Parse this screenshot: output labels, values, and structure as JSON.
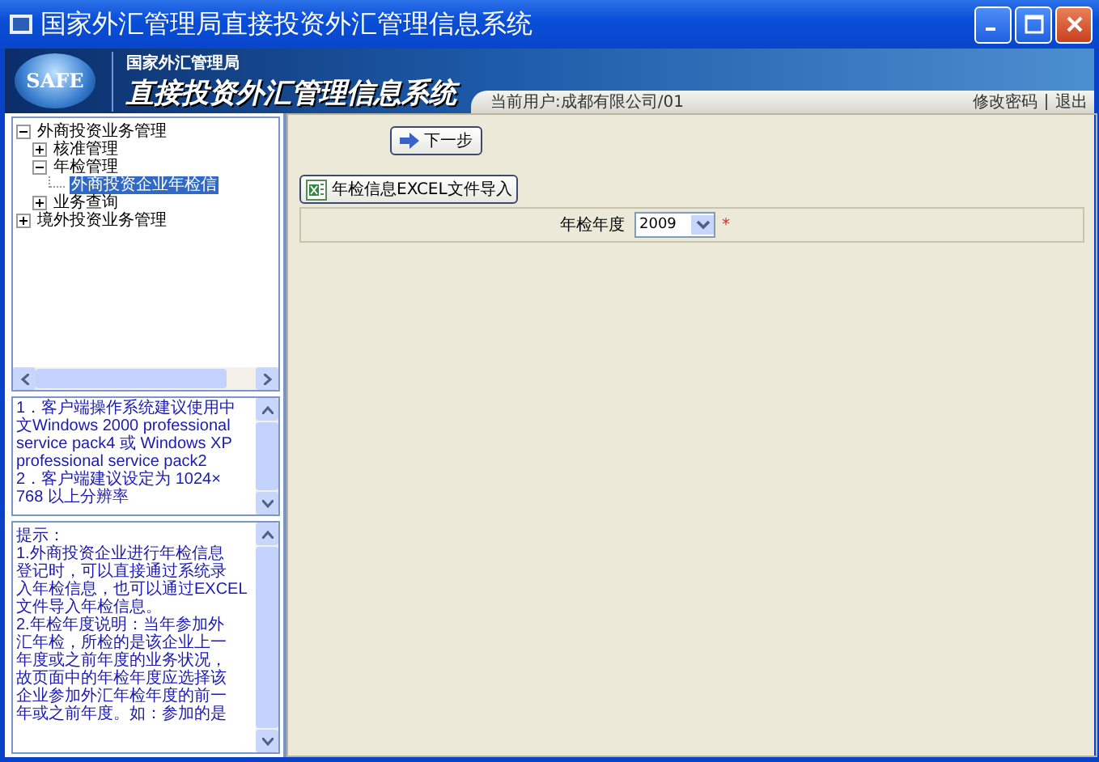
{
  "window": {
    "title": "国家外汇管理局直接投资外汇管理信息系统"
  },
  "header": {
    "logo": "SAFE",
    "subtitle": "国家外汇管理局",
    "title": "直接投资外汇管理信息系统",
    "current_user": "当前用户:成都有限公司/01",
    "links": [
      "修改密码",
      "退出"
    ]
  },
  "tree": [
    {
      "label": "外商投资业务管理",
      "expanded": true,
      "selected": false,
      "children": [
        {
          "label": "核准管理",
          "expanded": false,
          "selected": false
        },
        {
          "label": "年检管理",
          "expanded": true,
          "selected": false,
          "children": [
            {
              "label": "外商投资企业年检信",
              "selected": true
            }
          ]
        },
        {
          "label": "业务查询",
          "expanded": false,
          "selected": false
        }
      ]
    },
    {
      "label": "境外投资业务管理",
      "expanded": false,
      "selected": false
    }
  ],
  "notice": [
    "1．客户端操作系统建议使用中",
    "文Windows 2000 professional",
    "service pack4 或 Windows XP",
    "professional service pack2",
    "2．客户端建议设定为 1024×",
    "768 以上分辨率"
  ],
  "tips": [
    "提示：",
    "1.外商投资企业进行年检信息",
    "登记时，可以直接通过系统录",
    "入年检信息，也可以通过EXCEL",
    "文件导入年检信息。",
    "2.年检年度说明：当年参加外",
    "汇年检，所检的是该企业上一",
    "年度或之前年度的业务状况，",
    "故页面中的年检年度应选择该",
    "企业参加外汇年检年度的前一",
    "年或之前年度。如：参加的是"
  ],
  "content": {
    "next_button": "下一步",
    "import_button": "年检信息EXCEL文件导入",
    "form": {
      "label": "年检年度",
      "value": "2009",
      "required": "*"
    }
  }
}
